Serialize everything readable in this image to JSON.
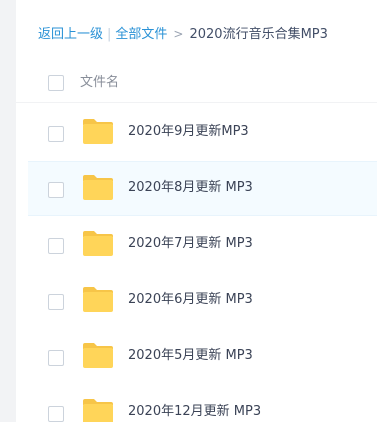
{
  "breadcrumb": {
    "back": "返回上一级",
    "separator": "|",
    "all_files": "全部文件",
    "arrow": ">",
    "current": "2020流行音乐合集MP3"
  },
  "list_header": {
    "name_column": "文件名"
  },
  "files": [
    {
      "name": "2020年9月更新MP3",
      "type": "folder-icon"
    },
    {
      "name": "2020年8月更新 MP3",
      "type": "folder-icon"
    },
    {
      "name": "2020年7月更新 MP3",
      "type": "folder-icon"
    },
    {
      "name": "2020年6月更新 MP3",
      "type": "folder-icon"
    },
    {
      "name": "2020年5月更新 MP3",
      "type": "folder-icon"
    },
    {
      "name": "2020年12月更新 MP3",
      "type": "folder-icon"
    }
  ],
  "colors": {
    "link": "#2a92d6",
    "folder": "#ffd559",
    "row_hover": "#f4fbff"
  }
}
